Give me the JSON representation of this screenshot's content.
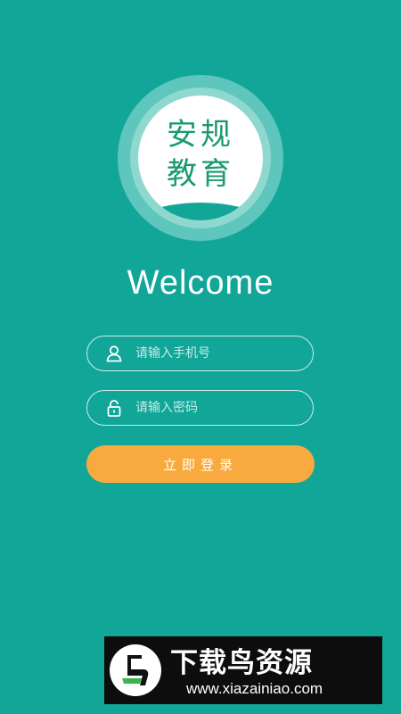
{
  "logo": {
    "line1": "安规",
    "line2": "教育"
  },
  "welcome_title": "Welcome",
  "form": {
    "phone_placeholder": "请输入手机号",
    "password_placeholder": "请输入密码",
    "login_label": "立即登录"
  },
  "watermark": {
    "title": "下载鸟资源",
    "url": "www.xiazainiao.com"
  },
  "colors": {
    "background": "#11a698",
    "button": "#f8aa3e",
    "logo_text": "#1a9a6e"
  }
}
